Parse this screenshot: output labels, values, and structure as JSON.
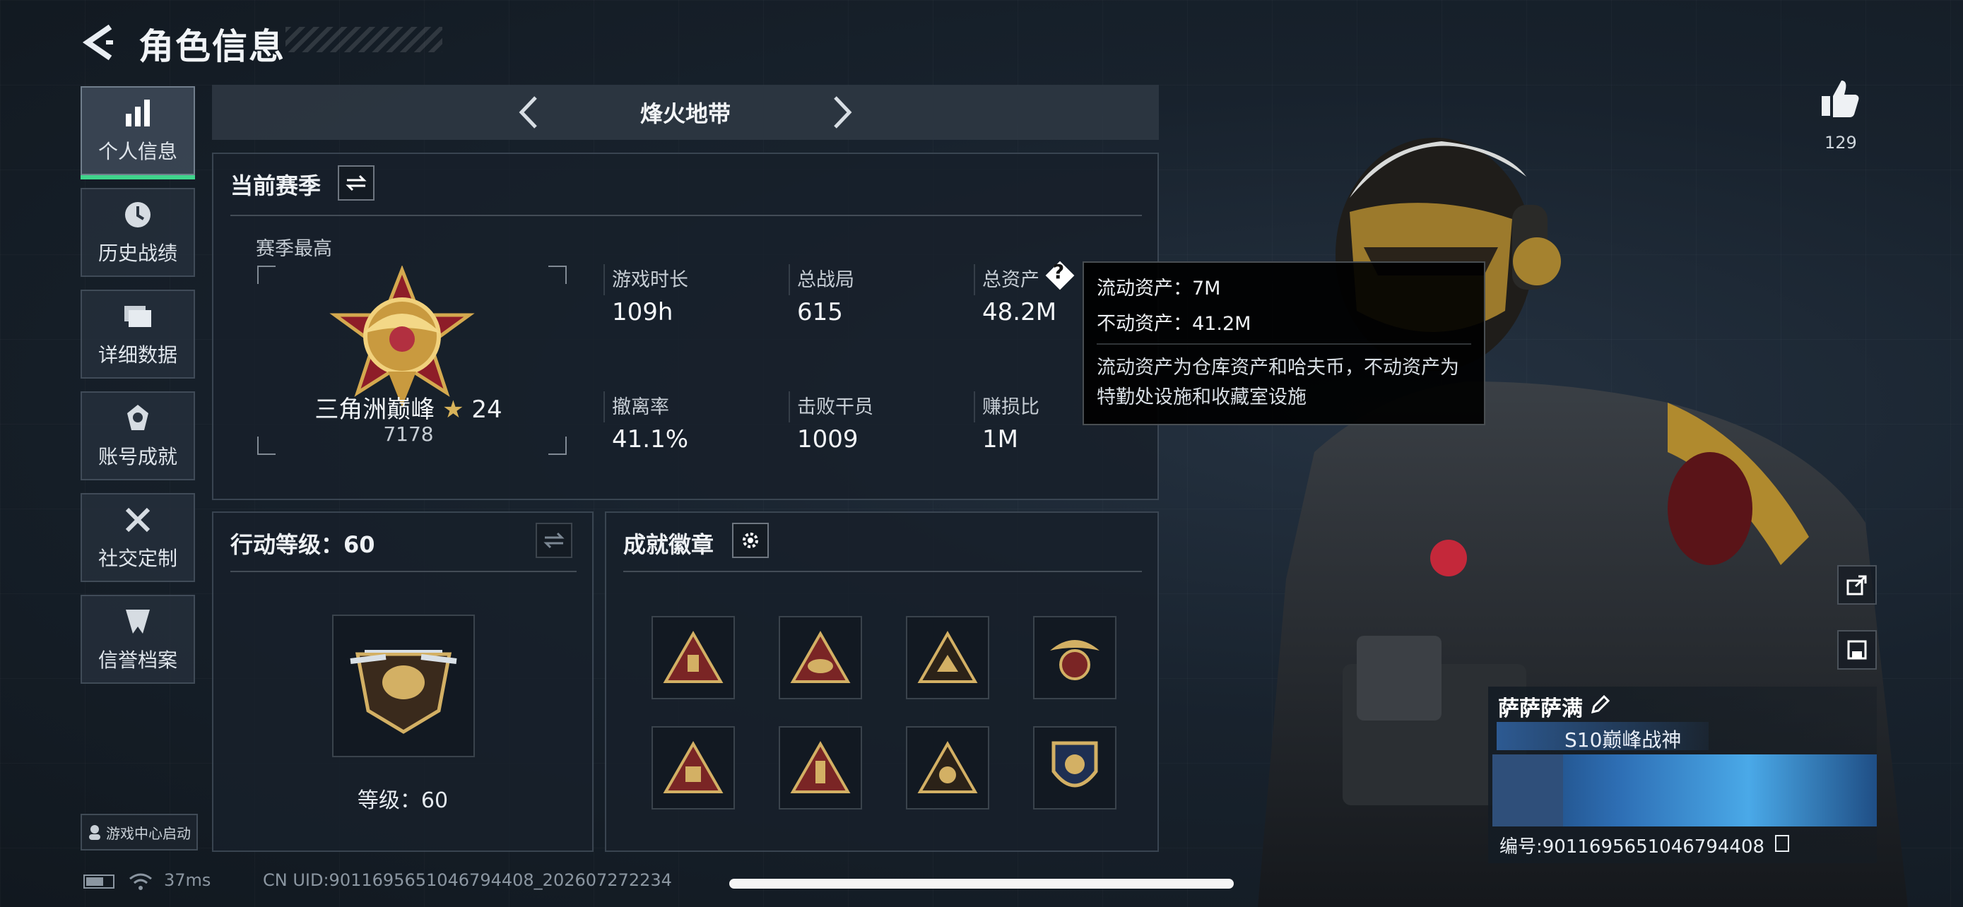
{
  "header": {
    "title": "角色信息"
  },
  "nav": {
    "items": [
      {
        "label": "个人信息",
        "icon": "bar-chart-icon",
        "active": true
      },
      {
        "label": "历史战绩",
        "icon": "history-clock-icon"
      },
      {
        "label": "详细数据",
        "icon": "folder-icon"
      },
      {
        "label": "账号成就",
        "icon": "medal-icon"
      },
      {
        "label": "社交定制",
        "icon": "tools-icon"
      },
      {
        "label": "信誉档案",
        "icon": "shield-icon"
      }
    ],
    "launch_label": "游戏中心启动"
  },
  "mode": {
    "label": "烽火地带"
  },
  "season": {
    "title": "当前赛季",
    "best_label": "赛季最高",
    "rank_name": "三角洲巅峰",
    "rank_stars": "24",
    "rank_score": "7178",
    "stats": [
      {
        "label": "游戏时长",
        "value": "109h"
      },
      {
        "label": "总战局",
        "value": "615"
      },
      {
        "label": "总资产",
        "value": "48.2M"
      },
      {
        "label": "撤离率",
        "value": "41.1%"
      },
      {
        "label": "击败干员",
        "value": "1009"
      },
      {
        "label": "赚损比",
        "value": "1M"
      }
    ],
    "help_icon": "?"
  },
  "tooltip": {
    "liquid": "流动资产：7M",
    "fixed": "不动资产：41.2M",
    "desc": "流动资产为仓库资产和哈夫币，不动资产为特勤处设施和收藏室设施"
  },
  "action_level": {
    "title": "行动等级：60",
    "level_label": "等级：60"
  },
  "achievements": {
    "title": "成就徽章",
    "badges": [
      "badge-1",
      "badge-2",
      "badge-3",
      "badge-4",
      "badge-5",
      "badge-6",
      "badge-7",
      "badge-8"
    ]
  },
  "profile": {
    "likes": "129",
    "name": "萨萨萨满",
    "title": "S10巅峰战神",
    "id_text": "编号:9011695651046794408"
  },
  "status_bar": {
    "ping": "37ms",
    "uid": "CN UID:9011695651046794408_202607272234"
  },
  "colors": {
    "accent": "#3fd58c",
    "gold": "#c9a24a",
    "panel": "#18202a"
  }
}
